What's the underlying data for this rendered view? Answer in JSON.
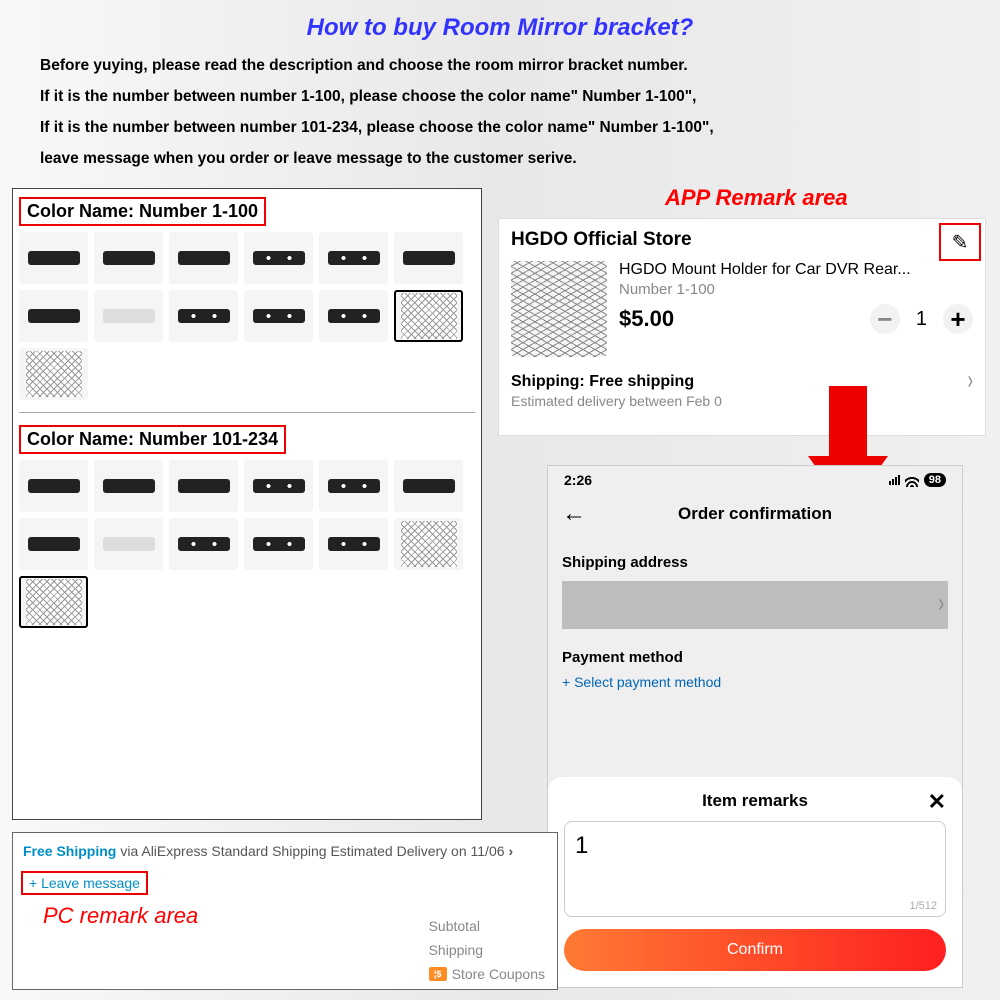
{
  "title": "How to buy Room Mirror bracket?",
  "instructions": [
    "Before yuying, please read the description and choose the room mirror bracket number.",
    "If it is the number between number 1-100, please choose the color name\" Number 1-100\",",
    "If it is the number between number 101-234, please choose the color name\" Number 1-100\",",
    "leave message when you order or leave message to the customer serive."
  ],
  "selection": {
    "group1_label": "Color Name: Number 1-100",
    "group2_label": "Color Name: Number 101-234"
  },
  "app_remark_label": "APP Remark area",
  "app_card": {
    "store": "HGDO Official Store",
    "edit_icon": "✎",
    "product_title": "HGDO Mount Holder for Car DVR Rear...",
    "variant": "Number 1-100",
    "price": "$5.00",
    "quantity": "1",
    "shipping_title": "Shipping: Free shipping",
    "shipping_est": "Estimated delivery between Feb 0"
  },
  "phone": {
    "time": "2:26",
    "battery": "98",
    "title": "Order confirmation",
    "shipping_addr_h": "Shipping address",
    "payment_h": "Payment method",
    "select_payment": "+ Select payment method",
    "remarks_h": "Item remarks",
    "remark_value": "1",
    "char_count": "1/512",
    "confirm": "Confirm"
  },
  "pc": {
    "free_shipping": "Free Shipping",
    "via": "via AliExpress Standard Shipping  Estimated Delivery on 11/06",
    "leave_message": "+  Leave message",
    "label": "PC remark area",
    "subtotal": "Subtotal",
    "shipping": "Shipping",
    "coupons": "Store Coupons",
    "coupon_icon": "¦$"
  }
}
